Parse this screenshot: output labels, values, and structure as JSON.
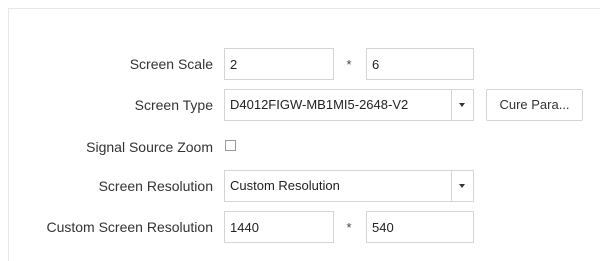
{
  "form": {
    "screen_scale": {
      "label": "Screen Scale",
      "width_value": "2",
      "separator": "*",
      "height_value": "6"
    },
    "screen_type": {
      "label": "Screen Type",
      "selected": "D4012FIGW-MB1MI5-2648-V2",
      "cure_button_label": "Cure Para..."
    },
    "signal_source_zoom": {
      "label": "Signal Source Zoom",
      "checked": false
    },
    "screen_resolution": {
      "label": "Screen Resolution",
      "selected": "Custom Resolution"
    },
    "custom_screen_resolution": {
      "label": "Custom Screen Resolution",
      "width_value": "1440",
      "separator": "*",
      "height_value": "540"
    }
  }
}
